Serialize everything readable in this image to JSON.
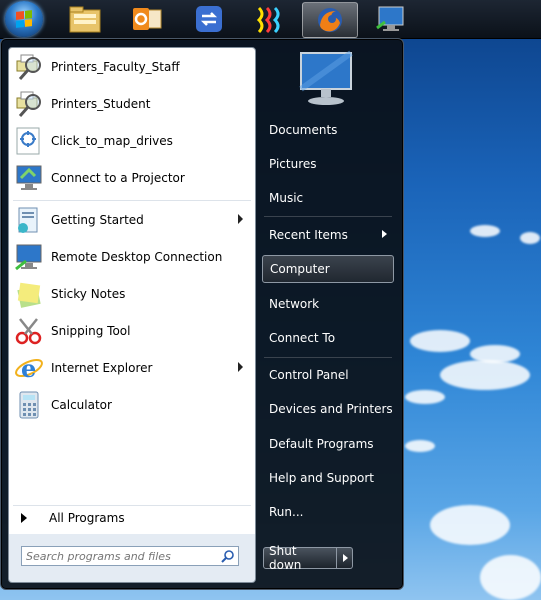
{
  "taskbar": {
    "icons": [
      "start-orb",
      "windows-explorer-icon",
      "outlook-icon",
      "sync-icon",
      "media-icon",
      "firefox-icon",
      "remote-desktop-icon"
    ]
  },
  "pinned": [
    {
      "label": "Printers_Faculty_Staff",
      "icon": "printer-magnifier-icon",
      "arrow": false
    },
    {
      "label": "Printers_Student",
      "icon": "printer-magnifier-icon",
      "arrow": false
    },
    {
      "label": "Click_to_map_drives",
      "icon": "map-drives-icon",
      "arrow": false
    },
    {
      "label": "Connect to a Projector",
      "icon": "projector-icon",
      "arrow": false
    }
  ],
  "recent": [
    {
      "label": "Getting Started",
      "icon": "getting-started-icon",
      "arrow": true
    },
    {
      "label": "Remote Desktop Connection",
      "icon": "remote-desktop-icon",
      "arrow": false
    },
    {
      "label": "Sticky Notes",
      "icon": "sticky-notes-icon",
      "arrow": false
    },
    {
      "label": "Snipping Tool",
      "icon": "scissors-icon",
      "arrow": false
    },
    {
      "label": "Internet Explorer",
      "icon": "internet-explorer-icon",
      "arrow": true
    },
    {
      "label": "Calculator",
      "icon": "calculator-icon",
      "arrow": false
    }
  ],
  "all_programs": "All Programs",
  "search": {
    "placeholder": "Search programs and files"
  },
  "right": [
    {
      "label": "Documents",
      "arrow": false
    },
    {
      "label": "Pictures",
      "arrow": false
    },
    {
      "label": "Music",
      "arrow": false
    },
    {
      "label": "Recent Items",
      "arrow": true
    },
    {
      "label": "Computer",
      "arrow": false
    },
    {
      "label": "Network",
      "arrow": false
    },
    {
      "label": "Connect To",
      "arrow": false
    },
    {
      "label": "Control Panel",
      "arrow": false
    },
    {
      "label": "Devices and Printers",
      "arrow": false
    },
    {
      "label": "Default Programs",
      "arrow": false
    },
    {
      "label": "Help and Support",
      "arrow": false
    },
    {
      "label": "Run...",
      "arrow": false
    }
  ],
  "shutdown_label": "Shut down",
  "colors": {
    "accent": "#1a63b8",
    "menu_bg": "#0a1018"
  }
}
